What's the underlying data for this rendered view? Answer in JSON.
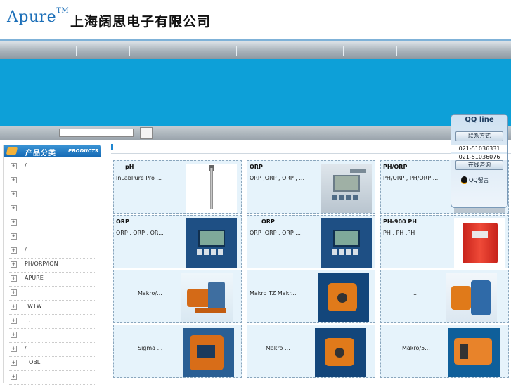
{
  "header": {
    "logo_text": "Apure",
    "logo_tm": "TM",
    "company_name": "上海阔思电子有限公司"
  },
  "qq_widget": {
    "title": "QQ line",
    "contact_button": "联系方式",
    "phones": [
      "021-51036331",
      "021-51036076"
    ],
    "consult_button": "在线咨询",
    "message_link": "QQ留言"
  },
  "sidebar": {
    "title": "产品分类",
    "subtitle": "PRODUCTS",
    "items": [
      {
        "label": "/"
      },
      {
        "label": ""
      },
      {
        "label": ""
      },
      {
        "label": ""
      },
      {
        "label": ""
      },
      {
        "label": ""
      },
      {
        "label": "/"
      },
      {
        "label": "PH/ORP/ION"
      },
      {
        "label": "APURE"
      },
      {
        "label": ""
      },
      {
        "label": "WTW"
      },
      {
        "label": "."
      },
      {
        "label": ""
      },
      {
        "label": "/"
      },
      {
        "label": "OBL"
      },
      {
        "label": ""
      }
    ]
  },
  "products": [
    {
      "title": "pH",
      "desc": "InLabPure Pro      ...",
      "image": "probe-electrode"
    },
    {
      "title": "ORP",
      "desc": "ORP ,ORP  , ORP , ...",
      "image": "analyzer-device"
    },
    {
      "title": "PH/ORP",
      "desc": "PH/ORP  , PH/ORP  ...",
      "image": "analyzer-device"
    },
    {
      "title": "ORP",
      "desc": "ORP  , ORP  , OR...",
      "image": "blue-controller"
    },
    {
      "title": "ORP",
      "desc": "ORP ,ORP  ,  ORP ...",
      "image": "blue-controller"
    },
    {
      "title": "PH-900   PH",
      "desc": "PH , PH ,PH",
      "image": "red-controller"
    },
    {
      "title": "",
      "desc": "Makro/...",
      "image": "pump"
    },
    {
      "title": "",
      "desc": "Makro TZ     Makr...",
      "image": "pump"
    },
    {
      "title": "",
      "desc": "...",
      "image": "pump"
    },
    {
      "title": "",
      "desc": "Sigma ...",
      "image": "pump"
    },
    {
      "title": "",
      "desc": "Makro     ...",
      "image": "pump"
    },
    {
      "title": "",
      "desc": "Makro/5...",
      "image": "pump"
    }
  ]
}
